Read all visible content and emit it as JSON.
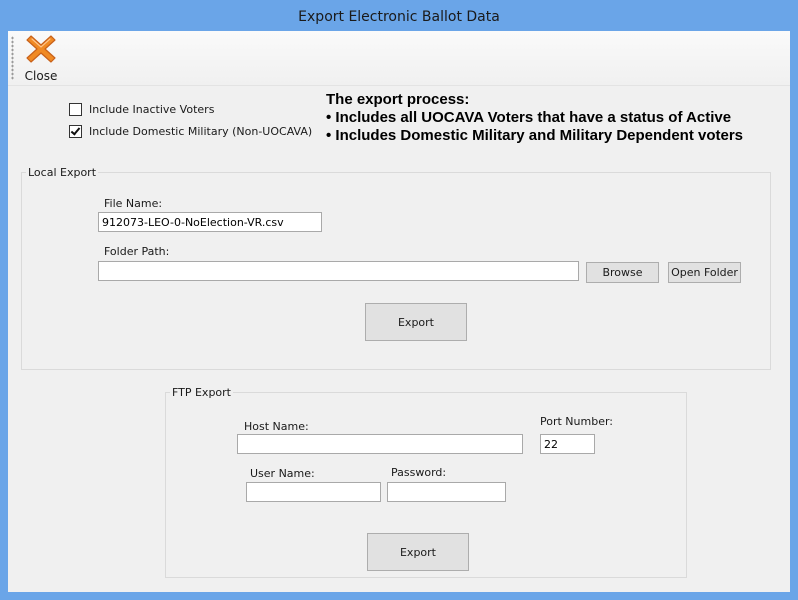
{
  "window": {
    "title": "Export Electronic Ballot Data"
  },
  "toolbar": {
    "close_label": "Close",
    "close_icon": "close-x-icon"
  },
  "options": {
    "include_inactive": {
      "label": "Include Inactive Voters",
      "checked": false
    },
    "include_domestic_military": {
      "label": "Include Domestic Military (Non-UOCAVA)",
      "checked": true
    }
  },
  "info": {
    "heading": "The export process:",
    "bullets": [
      "• Includes all UOCAVA Voters that have a status of Active",
      "• Includes Domestic Military and Military Dependent voters"
    ]
  },
  "local_export": {
    "legend": "Local Export",
    "file_name_label": "File Name:",
    "file_name_value": "912073-LEO-0-NoElection-VR.csv",
    "folder_path_label": "Folder Path:",
    "folder_path_value": "",
    "browse_label": "Browse",
    "open_folder_label": "Open Folder",
    "export_label": "Export"
  },
  "ftp_export": {
    "legend": "FTP Export",
    "host_name_label": "Host Name:",
    "host_name_value": "",
    "port_number_label": "Port Number:",
    "port_number_value": "22",
    "user_name_label": "User Name:",
    "user_name_value": "",
    "password_label": "Password:",
    "password_value": "",
    "export_label": "Export"
  },
  "colors": {
    "title_bar": "#6aa5e8",
    "client_bg": "#f0f0f0",
    "close_icon": "#f08a24"
  }
}
